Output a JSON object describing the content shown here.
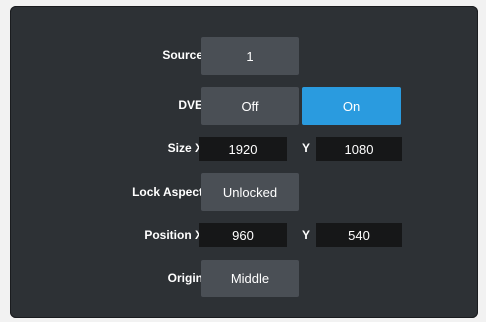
{
  "rows": {
    "source": {
      "label": "Source",
      "value": "1"
    },
    "dve": {
      "label": "DVE",
      "off": "Off",
      "on": "On",
      "selected": "On"
    },
    "size": {
      "label": "Size X",
      "x": "1920",
      "y_label": "Y",
      "y": "1080"
    },
    "lock_aspect": {
      "label": "Lock Aspect",
      "value": "Unlocked"
    },
    "position": {
      "label": "Position X",
      "x": "960",
      "y_label": "Y",
      "y": "540"
    },
    "origin": {
      "label": "Origin",
      "value": "Middle"
    }
  },
  "colors": {
    "panel_bg": "#2d3135",
    "button_bg": "#4a4f55",
    "active_accent": "#2a9bdf",
    "field_bg": "#161718"
  }
}
